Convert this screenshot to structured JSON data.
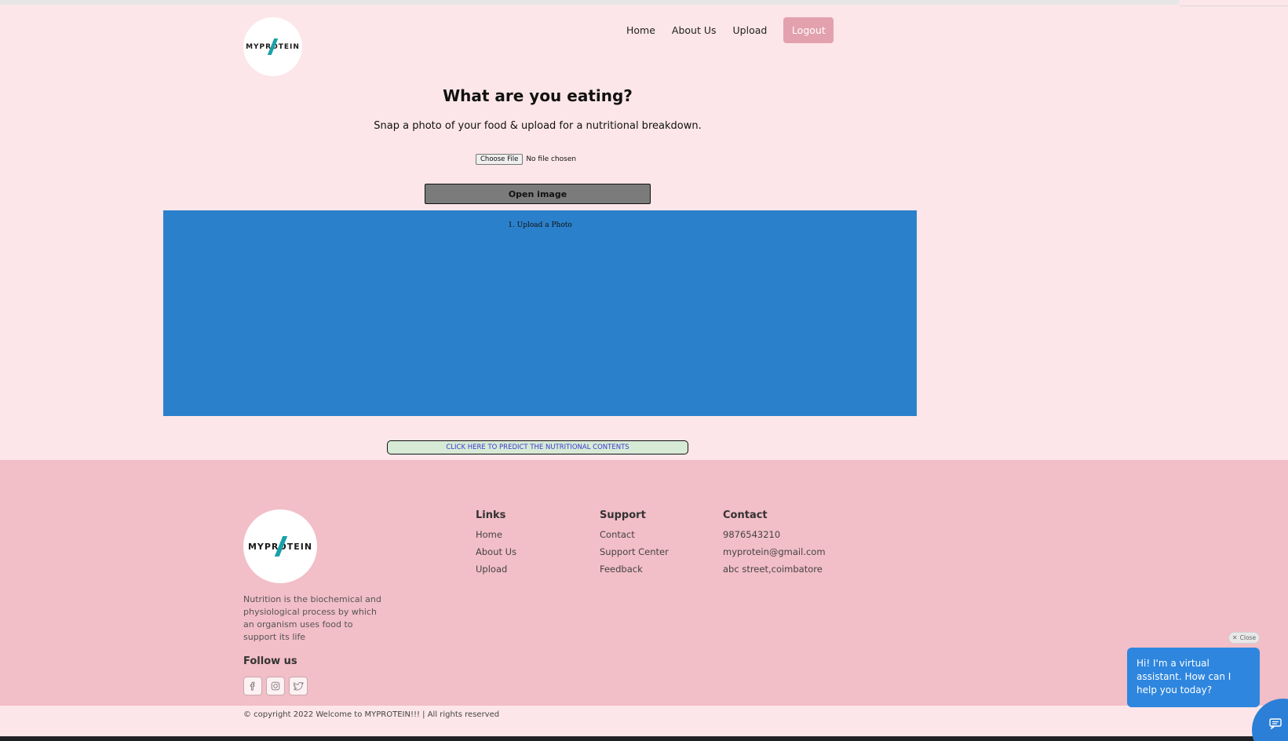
{
  "header": {
    "logo_text": "MYPROTEIN",
    "nav": [
      "Home",
      "About Us",
      "Upload"
    ],
    "logout_label": "Logout"
  },
  "main": {
    "title": "What are you eating?",
    "subtitle": "Snap a photo of your food & upload for a nutritional breakdown.",
    "choose_file_label": "Choose File",
    "file_status": "No file chosen",
    "open_image_label": "Open image",
    "photo_caption": "1. Upload a Photo",
    "predict_label": "CLICK HERE TO PREDICT THE NUTRITIONAL CONTENTS"
  },
  "footer": {
    "logo_text": "MYPROTEIN",
    "description": "Nutrition is the biochemical and physiological process by which an organism uses food to support its life",
    "follow_title": "Follow us",
    "socials": [
      "facebook-icon",
      "instagram-icon",
      "twitter-icon"
    ],
    "links": {
      "title": "Links",
      "items": [
        "Home",
        "About Us",
        "Upload"
      ]
    },
    "support": {
      "title": "Support",
      "items": [
        "Contact",
        "Support Center",
        "Feedback"
      ]
    },
    "contact": {
      "title": "Contact",
      "items": [
        "9876543210",
        "myprotein@gmail.com",
        "abc street,coimbatore"
      ]
    },
    "copyright": "© copyright 2022 Welcome to MYPROTEIN!!! | All rights reserved"
  },
  "chat": {
    "close_label": "Close",
    "message": "Hi! I'm a virtual assistant. How can I help you today?"
  },
  "colors": {
    "page_bg": "#fce6e9",
    "footer_bg": "#f2bec7",
    "logout_bg": "#e2a1ad",
    "photo_area_bg": "#2b80cb",
    "chat_bg": "#2e86de",
    "logo_accent": "#1ba0a8"
  }
}
